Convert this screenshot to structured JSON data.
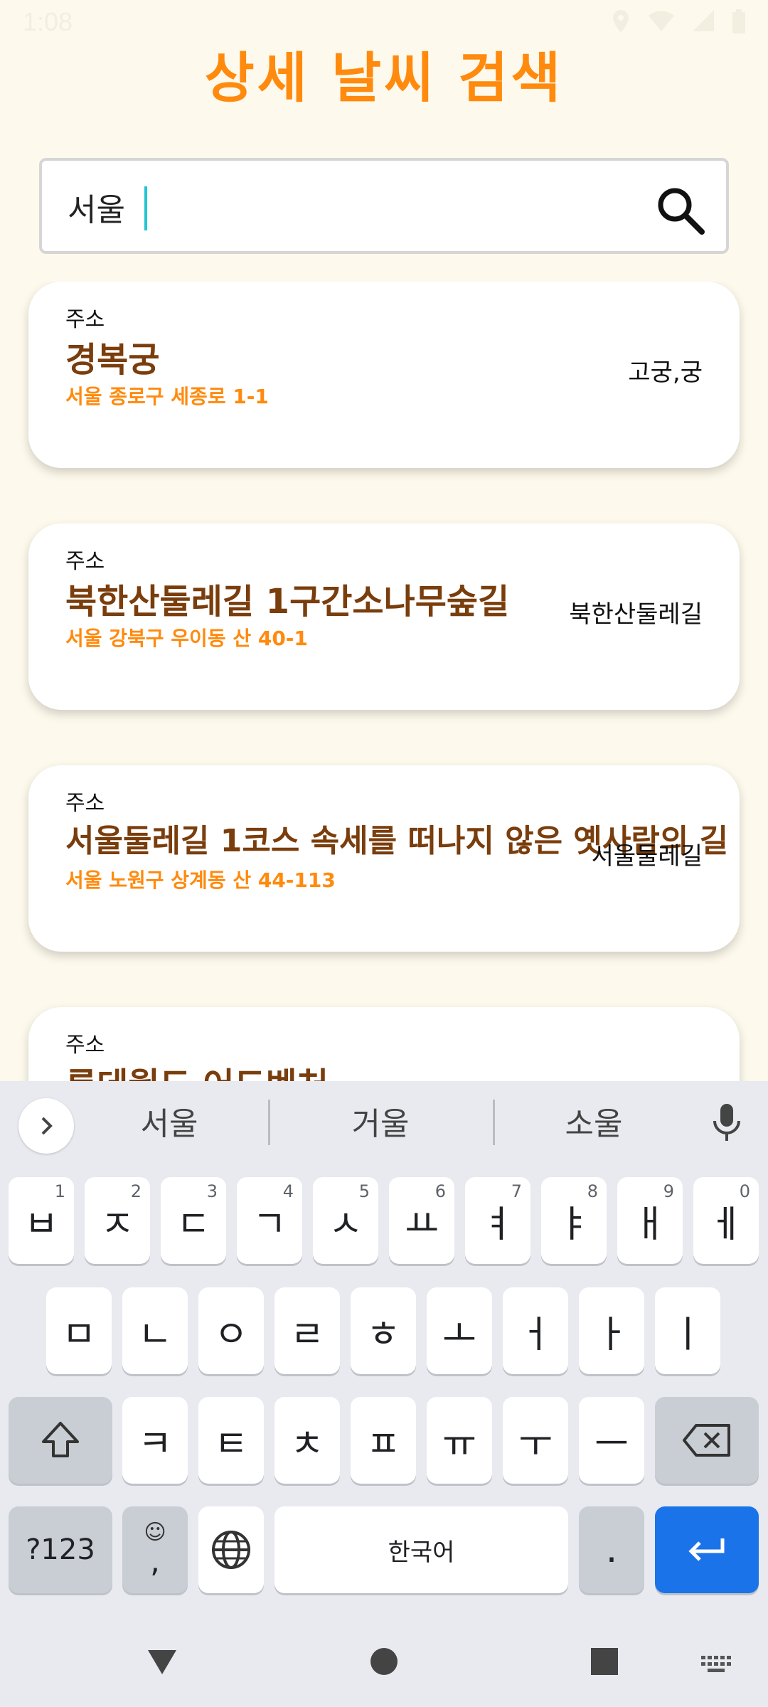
{
  "status": {
    "time": "1:08"
  },
  "app": {
    "title": "상세 날씨 검색"
  },
  "search": {
    "value": "서울",
    "placeholder": ""
  },
  "results": [
    {
      "label": "주소",
      "title": "경복궁",
      "address": "서울 종로구 세종로 1-1",
      "category": "고궁,궁"
    },
    {
      "label": "주소",
      "title": "북한산둘레길 1구간소나무숲길",
      "address": "서울 강북구 우이동 산 40-1",
      "category": "북한산둘레길"
    },
    {
      "label": "주소",
      "title": "서울둘레길 1코스 속세를 떠나지 않은 옛사람의 길",
      "address": "서울 노원구 상계동 산 44-113",
      "category": "서울둘레길"
    },
    {
      "label": "주소",
      "title": "롯데월드 어드벤처",
      "address": "",
      "category": ""
    }
  ],
  "keyboard": {
    "suggestions": [
      "서울",
      "거울",
      "소울"
    ],
    "row1": [
      {
        "key": "ㅂ",
        "hint": "1"
      },
      {
        "key": "ㅈ",
        "hint": "2"
      },
      {
        "key": "ㄷ",
        "hint": "3"
      },
      {
        "key": "ㄱ",
        "hint": "4"
      },
      {
        "key": "ㅅ",
        "hint": "5"
      },
      {
        "key": "ㅛ",
        "hint": "6"
      },
      {
        "key": "ㅕ",
        "hint": "7"
      },
      {
        "key": "ㅑ",
        "hint": "8"
      },
      {
        "key": "ㅐ",
        "hint": "9"
      },
      {
        "key": "ㅔ",
        "hint": "0"
      }
    ],
    "row2": [
      "ㅁ",
      "ㄴ",
      "ㅇ",
      "ㄹ",
      "ㅎ",
      "ㅗ",
      "ㅓ",
      "ㅏ",
      "ㅣ"
    ],
    "row3": [
      "ㅋ",
      "ㅌ",
      "ㅊ",
      "ㅍ",
      "ㅠ",
      "ㅜ",
      "ㅡ"
    ],
    "symbols_label": "?123",
    "emoji_label": "☺",
    "comma_label": ",",
    "space_label": "한국어",
    "period_label": "."
  },
  "colors": {
    "accent": "#ff8a0d",
    "title_brown": "#7a3d0c",
    "enter_blue": "#1a73e8",
    "background": "#fdf9ec"
  }
}
